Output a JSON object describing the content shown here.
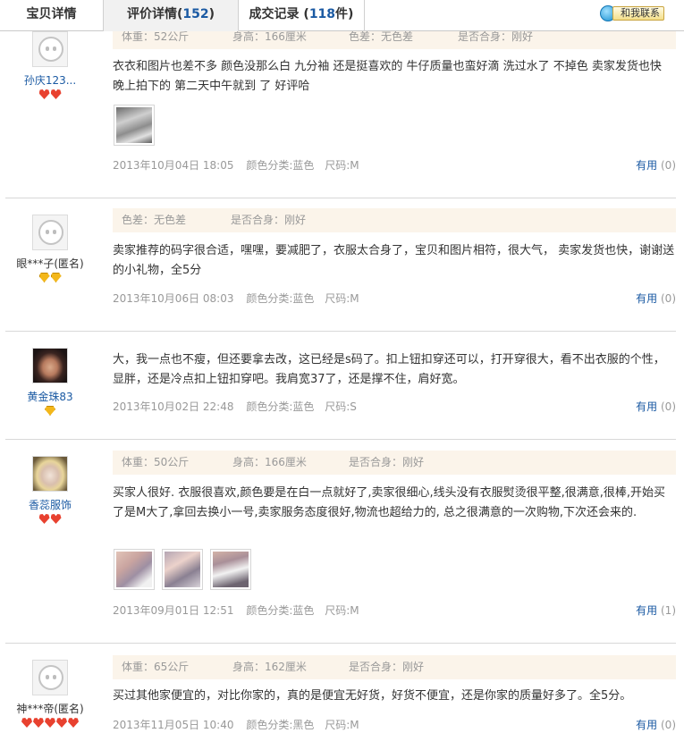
{
  "tabs": [
    {
      "label": "宝贝详情",
      "count": ""
    },
    {
      "label": "评价详情",
      "count": "152",
      "prefix": "(",
      "suffix": ")"
    },
    {
      "label": "成交记录",
      "count": "118",
      "prefix": " (",
      "suffix": "件)"
    }
  ],
  "contact_label": "和我联系",
  "reviews": [
    {
      "user": "孙庆123...",
      "attrs": [
        "体重：52公斤",
        "身高：166厘米",
        "色差：无色差",
        "是否合身：刚好"
      ],
      "content": "衣衣和图片也差不多 颜色没那么白 九分袖 还是挺喜欢的 牛仔质量也蛮好滴 洗过水了 不掉色 卖家发货也快 晚上拍下的 第二天中午就到 了 好评哈",
      "date": "2013年10月04日 18:05",
      "color": "颜色分类:蓝色",
      "size": "尺码:M",
      "useful_label": "有用",
      "useful_count": "(0)"
    },
    {
      "user": "眼***子(匿名)",
      "attrs": [
        "色差：无色差",
        "是否合身：刚好"
      ],
      "content": "卖家推荐的码字很合适，嘿嘿，要减肥了，衣服太合身了，宝贝和图片相符，很大气， 卖家发货也快，谢谢送的小礼物，全5分",
      "date": "2013年10月06日 08:03",
      "color": "颜色分类:蓝色",
      "size": "尺码:M",
      "useful_label": "有用",
      "useful_count": "(0)"
    },
    {
      "user": "黄金珠83",
      "attrs": [],
      "content": "大，我一点也不瘦，但还要拿去改，这已经是s码了。扣上钮扣穿还可以，打开穿很大，看不出衣服的个性，显胖，还是冷点扣上钮扣穿吧。我肩宽37了，还是撑不住，肩好宽。",
      "date": "2013年10月02日 22:48",
      "color": "颜色分类:蓝色",
      "size": "尺码:S",
      "useful_label": "有用",
      "useful_count": "(0)"
    },
    {
      "user": "香蕊服饰",
      "attrs": [
        "体重：50公斤",
        "身高：166厘米",
        "是否合身：刚好"
      ],
      "content": "买家人很好. 衣服很喜欢,颜色要是在白一点就好了,卖家很细心,线头没有衣服熨烫很平整,很满意,很棒,开始买了是M大了,拿回去换小一号,卖家服务态度很好,物流也超给力的, 总之很满意的一次购物,下次还会来的.",
      "date": "2013年09月01日 12:51",
      "color": "颜色分类:蓝色",
      "size": "尺码:M",
      "useful_label": "有用",
      "useful_count": "(1)"
    },
    {
      "user": "神***帝(匿名)",
      "attrs": [
        "体重：65公斤",
        "身高：162厘米",
        "是否合身：刚好"
      ],
      "content": "买过其他家便宜的，对比你家的，真的是便宜无好货，好货不便宜，还是你家的质量好多了。全5分。",
      "date": "2013年11月05日 10:40",
      "color": "颜色分类:黑色",
      "size": "尺码:M",
      "useful_label": "有用",
      "useful_count": "(0)"
    }
  ],
  "colors": {
    "link": "#1b5aa3",
    "attr_bg": "#fbf4ea",
    "heart": "#e8412f",
    "diamond": "#f3b71a"
  },
  "icons": {
    "contact": "chat-bubble-icon",
    "default_avatar": "default-avatar-icon"
  }
}
